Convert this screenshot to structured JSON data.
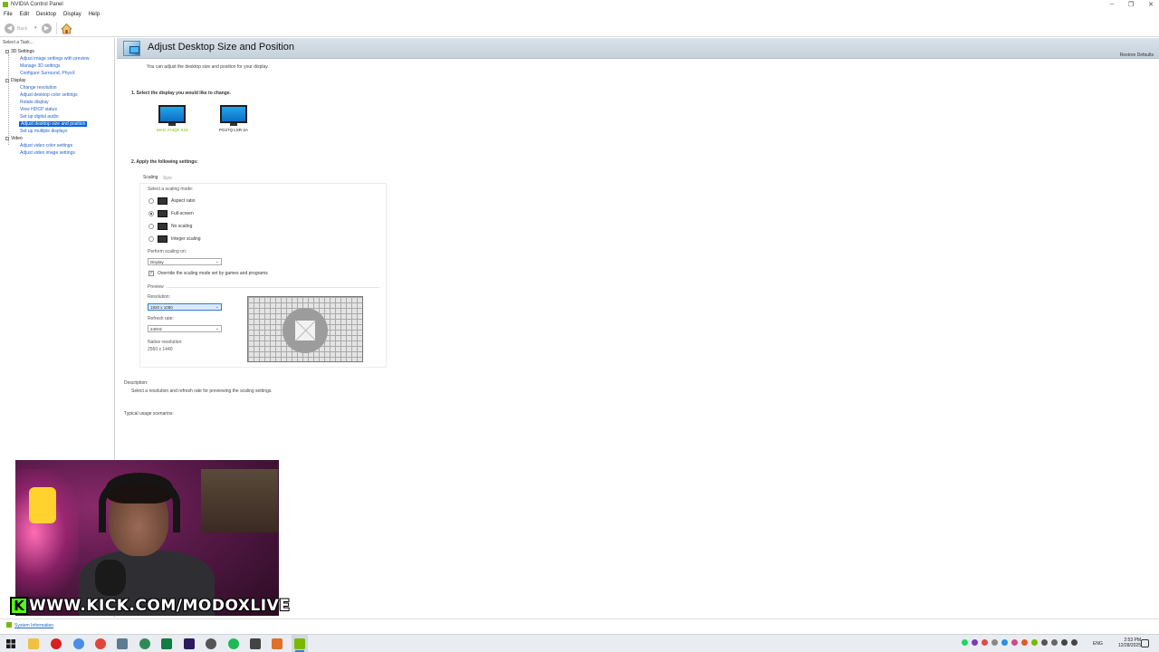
{
  "window": {
    "title": "NVIDIA Control Panel",
    "minimize": "–",
    "maximize": "❐",
    "close": "✕"
  },
  "menu": [
    "File",
    "Edit",
    "Desktop",
    "Display",
    "Help"
  ],
  "toolbar": {
    "back_label": "Back",
    "dropdown": "▾"
  },
  "sidebar": {
    "task_label": "Select a Task...",
    "categories": {
      "settings3d": "3D Settings",
      "display": "Display",
      "video": "Video"
    },
    "items": [
      "Adjust image settings with preview",
      "Manage 3D settings",
      "Configure Surround, PhysX",
      "Change resolution",
      "Adjust desktop color settings",
      "Rotate display",
      "View HDCP status",
      "Set up digital audio",
      "Adjust desktop size and position",
      "Set up multiple displays",
      "Adjust video color settings",
      "Adjust video image settings"
    ]
  },
  "main": {
    "title": "Adjust Desktop Size and Position",
    "restore_defaults": "Restore Defaults",
    "subtitle": "You can adjust the desktop size and position for your display.",
    "step1": "1. Select the display you would like to change.",
    "displays": [
      "MAG 274QF X24",
      "PG27Q LSR-2A"
    ],
    "step2": "2. Apply the following settings:",
    "tabs": [
      "Scaling",
      "Size"
    ],
    "scaling_mode_label": "Select a scaling mode:",
    "scaling_modes": [
      "Aspect ratio",
      "Full-screen",
      "No scaling",
      "Integer scaling"
    ],
    "perform_scaling_label": "Perform scaling on:",
    "perform_scaling_value": "Display",
    "override_label": "Override the scaling mode set by games and programs",
    "override_check": "✓",
    "preview_label": "Preview",
    "resolution_label": "Resolution:",
    "resolution_value": "1920 x 1080",
    "refresh_label": "Refresh rate:",
    "refresh_value": "240Hz",
    "native_label": "Native resolution:",
    "native_value": "2560 x 1440",
    "chevron": "⌄",
    "description_label": "Description:",
    "description_text": "Select a resolution and refresh rate for previewing the scaling settings.",
    "usage_label": "Typical usage scenarios:"
  },
  "status": {
    "system_info": "System Information"
  },
  "taskbar": {
    "lang": "ENG",
    "time": "2:53 PM",
    "date": "12/28/2025"
  },
  "stream_overlay": {
    "text": "WWW.KICK.COM/MODOXLIVE",
    "badge": "K",
    "brand_color": "#53fc18"
  },
  "colors": {
    "selection": "#0e62d8",
    "link": "#2a64c7",
    "nvidia_green": "#76b900"
  }
}
